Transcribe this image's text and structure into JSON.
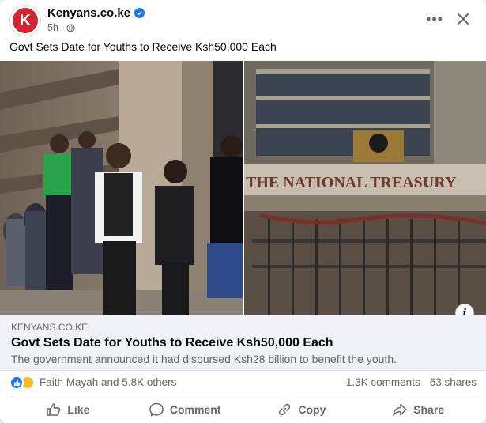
{
  "header": {
    "page_name": "Kenyans.co.ke",
    "time": "5h",
    "avatar_letter": "K"
  },
  "post": {
    "text": "Govt Sets Date for Youths to Receive Ksh50,000 Each"
  },
  "images": {
    "right_sign": "THE NATIONAL TREASURY"
  },
  "link_preview": {
    "domain": "KENYANS.CO.KE",
    "title": "Govt Sets Date for Youths to Receive Ksh50,000 Each",
    "description": "The government announced it had disbursed Ksh28 billion to benefit the youth."
  },
  "reactions": {
    "names": "Faith Mayah and 5.8K others",
    "comments": "1.3K comments",
    "shares": "63 shares"
  },
  "actions": {
    "like": "Like",
    "comment": "Comment",
    "copy": "Copy",
    "share": "Share"
  },
  "icons": {
    "avatar": "kenyans-logo-icon",
    "verified": "verified-badge-icon",
    "privacy": "globe-icon",
    "more": "more-options-icon",
    "close": "close-icon",
    "info": "info-icon",
    "like": "thumbs-up-icon",
    "comment": "comment-bubble-icon",
    "copy": "copy-link-icon",
    "share": "share-arrow-icon"
  },
  "colors": {
    "accent": "#1877f2",
    "brand_red": "#d9232e",
    "muted_text": "#65676b"
  }
}
